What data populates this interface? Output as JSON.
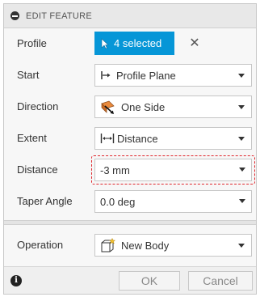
{
  "header": {
    "title": "EDIT FEATURE"
  },
  "profile": {
    "label": "Profile",
    "selection": "4 selected",
    "clear": "✕"
  },
  "start": {
    "label": "Start",
    "value": "Profile Plane"
  },
  "direction": {
    "label": "Direction",
    "value": "One Side"
  },
  "extent": {
    "label": "Extent",
    "value": "Distance"
  },
  "distance": {
    "label": "Distance",
    "value": "-3 mm"
  },
  "taper": {
    "label": "Taper Angle",
    "value": "0.0 deg"
  },
  "operation": {
    "label": "Operation",
    "value": "New Body"
  },
  "footer": {
    "info": "i",
    "ok": "OK",
    "cancel": "Cancel"
  },
  "colors": {
    "accent": "#0696d7",
    "highlight_dash": "#e0282e"
  }
}
